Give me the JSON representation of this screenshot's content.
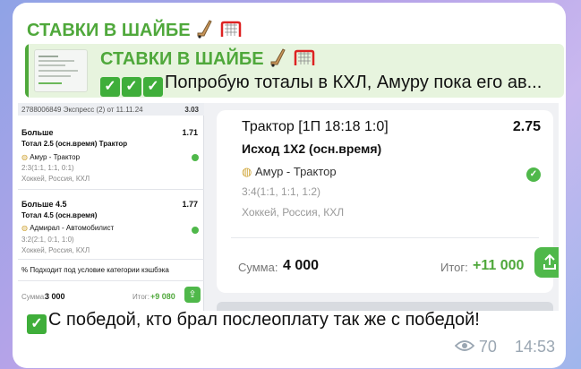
{
  "channel": {
    "name": "СТАВКИ В ШАЙБЕ"
  },
  "reply": {
    "title": "СТАВКИ В ШАЙБЕ",
    "text": "Попробую тоталы в КХЛ, Амуру пока его ав..."
  },
  "slip": {
    "header_id": "2788006849  Экспресс (2) от 11.11.24",
    "header_odds": "3.03",
    "bets": [
      {
        "type": "Больше",
        "odds": "1.71",
        "market": "Тотал 2.5 (осн.время)  Трактор",
        "match": "Амур - Трактор",
        "score": "2:3(1:1, 1:1, 0:1)",
        "league": "Хоккей, Россия, КХЛ"
      },
      {
        "type": "Больше 4.5",
        "odds": "1.77",
        "market": "Тотал 4.5 (осн.время)",
        "match": "Адмирал - Автомобилист",
        "score": "3:2(2:1, 0:1, 1:0)",
        "league": "Хоккей, Россия, КХЛ"
      }
    ],
    "cashback": "Подходит под условие категории кэшбэка",
    "stake_label": "Сумма:",
    "stake": "3 000",
    "result_label": "Итог:",
    "result": "+9 080"
  },
  "card": {
    "title": "Трактор [1П 18:18 1:0]",
    "odds": "2.75",
    "market": "Исход 1Х2 (осн.время)",
    "match": "Амур - Трактор",
    "score": "3:4(1:1, 1:1, 1:2)",
    "league": "Хоккей, Россия, КХЛ",
    "stake_label": "Сумма:",
    "stake": "4 000",
    "result_label": "Итог:",
    "result": "+11 000"
  },
  "message": "С победой, кто брал послеоплату так же с победой!",
  "views": "70",
  "time": "14:53",
  "colors": {
    "accent": "#4fa83b",
    "success": "#4fb84a"
  },
  "icons": [
    "hockey-stick-icon",
    "hockey-goal-icon",
    "check-icon",
    "ball-icon",
    "share-icon",
    "eye-icon"
  ]
}
